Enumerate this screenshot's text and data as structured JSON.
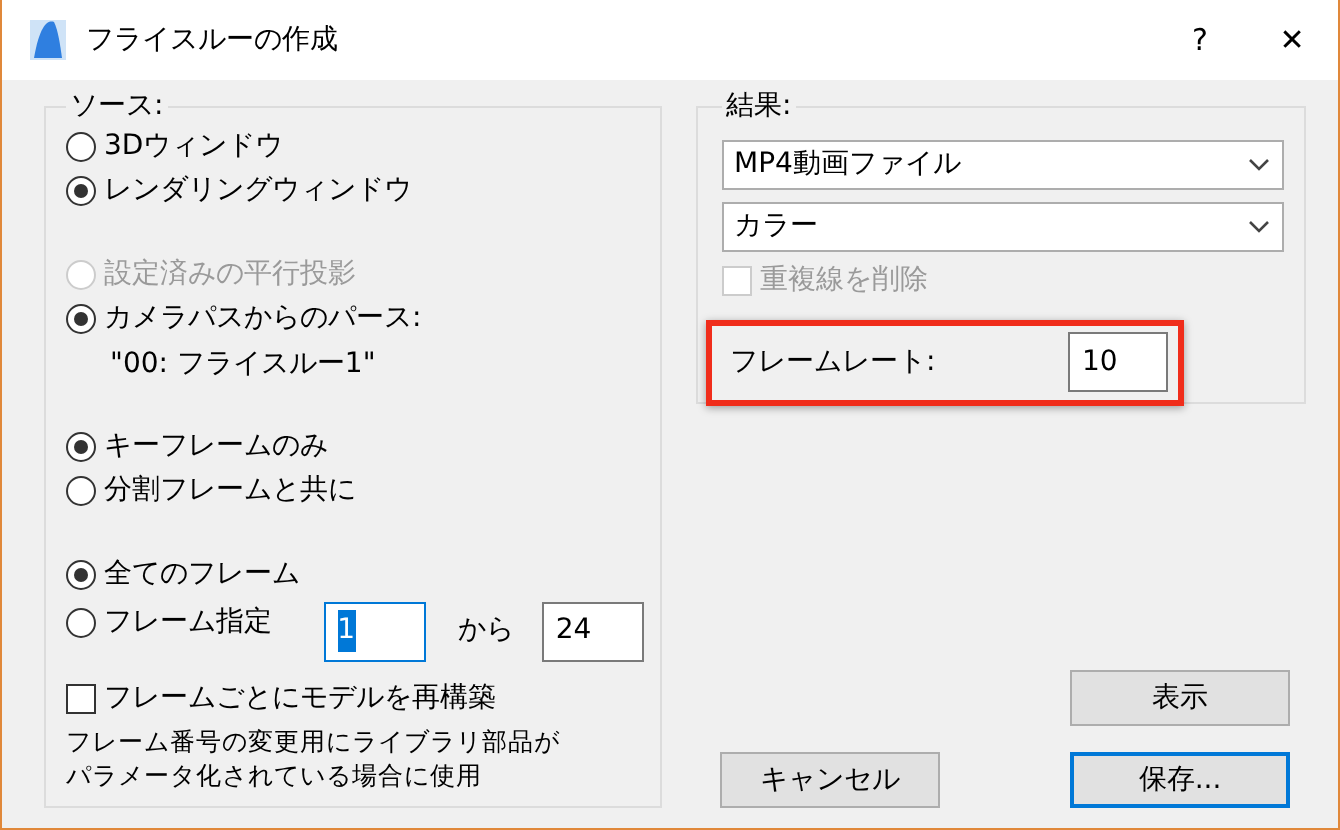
{
  "window": {
    "title": "フライスルーの作成",
    "help": "?",
    "close": "✕"
  },
  "source_group": {
    "label": "ソース:",
    "view_options": [
      {
        "label": "3Dウィンドウ",
        "selected": false,
        "disabled": false
      },
      {
        "label": "レンダリングウィンドウ",
        "selected": true,
        "disabled": false
      }
    ],
    "camera_options": [
      {
        "label": "設定済みの平行投影",
        "selected": false,
        "disabled": true
      },
      {
        "label": "カメラパスからのパース:",
        "selected": true,
        "disabled": false
      }
    ],
    "camera_path": "\"00: フライスルー1\"",
    "keyframe_options": [
      {
        "label": "キーフレームのみ",
        "selected": true,
        "disabled": false
      },
      {
        "label": "分割フレームと共に",
        "selected": false,
        "disabled": false
      }
    ],
    "frame_options": [
      {
        "label": "全てのフレーム",
        "selected": true,
        "disabled": false
      },
      {
        "label": "フレーム指定",
        "selected": false,
        "disabled": false
      }
    ],
    "frame_range": {
      "from": "1",
      "from_focused": true,
      "separator": "から",
      "to": "24"
    },
    "rebuild": {
      "label": "フレームごとにモデルを再構築",
      "checked": false,
      "disabled": false
    },
    "note_lines": [
      "フレーム番号の変更用にライブラリ部品が",
      "パラメータ化されている場合に使用"
    ]
  },
  "result_group": {
    "label": "結果:",
    "format": "MP4動画ファイル",
    "color_mode": "カラー",
    "remove_hidden": {
      "label": "重複線を削除",
      "checked": false,
      "disabled": true
    },
    "frame_rate": {
      "label": "フレームレート:",
      "value": "10",
      "highlighted": true
    }
  },
  "buttons": [
    {
      "label": "表示",
      "kind": "show",
      "default": false
    },
    {
      "label": "キャンセル",
      "kind": "cancel",
      "default": false
    },
    {
      "label": "保存...",
      "kind": "save",
      "default": true
    }
  ]
}
